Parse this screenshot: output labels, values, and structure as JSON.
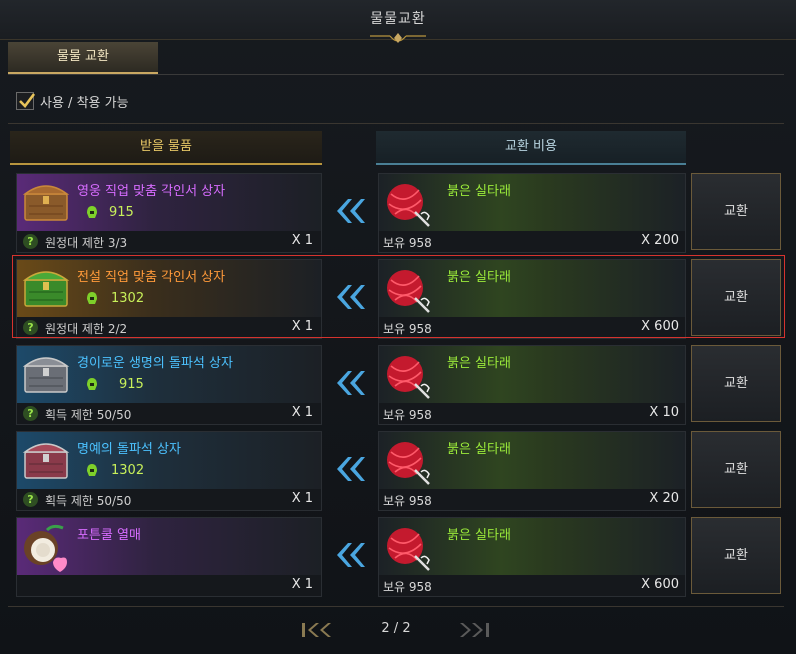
{
  "window": {
    "title": "물물교환"
  },
  "tabs": [
    {
      "label": "물물 교환"
    }
  ],
  "filter": {
    "label": "사용 / 착용 가능",
    "checked": true
  },
  "headers": {
    "receive": "받을 물품",
    "cost": "교환 비용"
  },
  "rows": [
    {
      "item_name": "영웅 직업 맞춤 각인서 상자",
      "grade": "purple",
      "icon": "chest-icon",
      "power": "915",
      "limit": "원정대 제한 3/3",
      "quantity": "X 1",
      "cost_item": "붉은 실타래",
      "cost_icon": "red-yarn-icon",
      "owned": "보유 958",
      "cost_qty": "X 200",
      "button": "교환"
    },
    {
      "item_name": "전설 직업 맞춤 각인서 상자",
      "grade": "orange",
      "icon": "chest-icon",
      "power": "1302",
      "limit": "원정대 제한 2/2",
      "quantity": "X 1",
      "cost_item": "붉은 실타래",
      "cost_icon": "red-yarn-icon",
      "owned": "보유 958",
      "cost_qty": "X 600",
      "button": "교환",
      "highlighted": true
    },
    {
      "item_name": "경이로운 생명의 돌파석 상자",
      "grade": "blue",
      "icon": "chest-icon",
      "power": "915",
      "limit": "획득 제한 50/50",
      "quantity": "X 1",
      "cost_item": "붉은 실타래",
      "cost_icon": "red-yarn-icon",
      "owned": "보유 958",
      "cost_qty": "X 10",
      "button": "교환"
    },
    {
      "item_name": "명예의 돌파석 상자",
      "grade": "blue",
      "icon": "chest-icon",
      "power": "1302",
      "limit": "획득 제한 50/50",
      "quantity": "X 1",
      "cost_item": "붉은 실타래",
      "cost_icon": "red-yarn-icon",
      "owned": "보유 958",
      "cost_qty": "X 20",
      "button": "교환"
    },
    {
      "item_name": "포튼쿨 열매",
      "grade": "purple",
      "icon": "coconut-icon",
      "power": "",
      "limit": "",
      "quantity": "X 1",
      "cost_item": "붉은 실타래",
      "cost_icon": "red-yarn-icon",
      "owned": "보유 958",
      "cost_qty": "X 600",
      "button": "교환"
    }
  ],
  "pager": {
    "text": "2 / 2"
  },
  "colors": {
    "highlight": "#d6332e",
    "gold": "#c9a862",
    "power": "#c8f05a",
    "cost_name": "#9aea3a"
  }
}
